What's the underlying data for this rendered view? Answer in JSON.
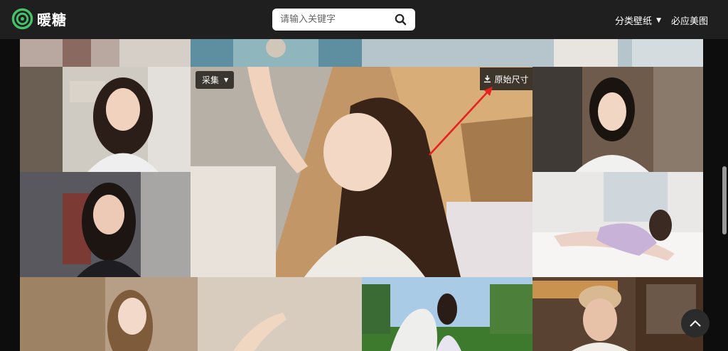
{
  "header": {
    "logo_text": "暖糖",
    "search_placeholder": "请输入关键字",
    "nav": [
      {
        "label": "分类壁纸",
        "has_dropdown": true
      },
      {
        "label": "必应美图",
        "has_dropdown": false
      }
    ]
  },
  "featured_overlay": {
    "collect_label": "采集",
    "original_size_label": "原始尺寸"
  },
  "icons": {
    "logo": "swirl-logo-icon",
    "search": "search-icon",
    "download": "download-icon",
    "back_to_top": "chevron-up-icon"
  },
  "colors": {
    "header_bg": "#1f1f1f",
    "page_bg": "#0d0d0d",
    "logo_green": "#46c26a",
    "annotation_arrow": "#e82020"
  }
}
